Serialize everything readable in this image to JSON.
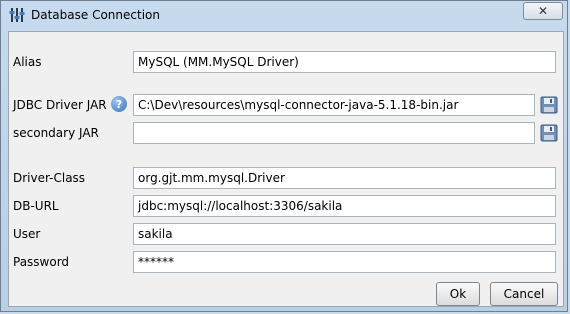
{
  "window": {
    "title": "Database Connection",
    "close_glyph": "✕"
  },
  "form": {
    "alias": {
      "label": "Alias",
      "value": "MySQL (MM.MySQL Driver)"
    },
    "jdbc_driver_jar": {
      "label": "JDBC Driver JAR",
      "value": "C:\\Dev\\resources\\mysql-connector-java-5.1.18-bin.jar",
      "help_glyph": "?"
    },
    "secondary_jar": {
      "label": "secondary JAR",
      "value": ""
    },
    "driver_class": {
      "label": "Driver-Class",
      "value": "org.gjt.mm.mysql.Driver"
    },
    "db_url": {
      "label": "DB-URL",
      "value": "jdbc:mysql://localhost:3306/sakila"
    },
    "user": {
      "label": "User",
      "value": "sakila"
    },
    "password": {
      "label": "Password",
      "value": "******"
    }
  },
  "buttons": {
    "ok": "Ok",
    "cancel": "Cancel"
  },
  "icons": {
    "app": "database-connection-icon",
    "help": "help-icon",
    "save": "floppy-disk-icon"
  }
}
